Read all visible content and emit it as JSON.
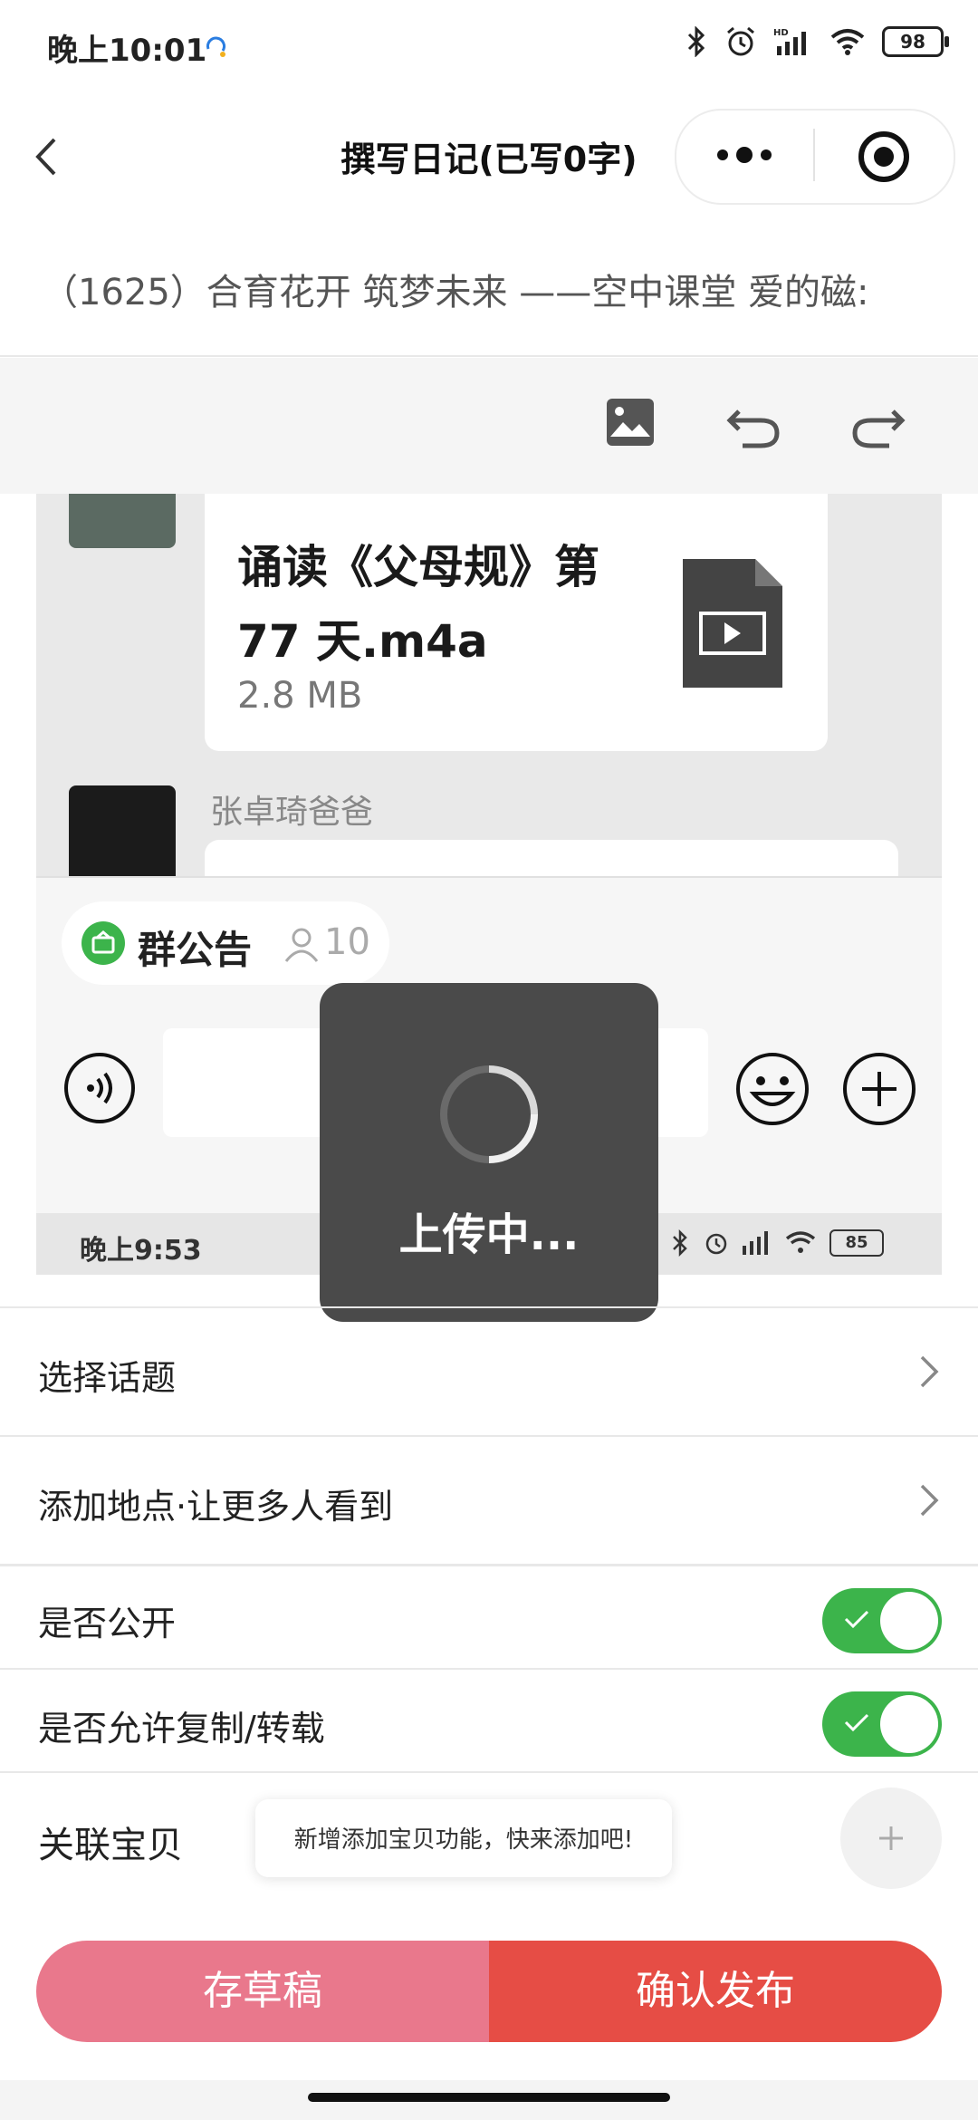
{
  "status_bar": {
    "time": "晚上10:01",
    "battery": "98"
  },
  "nav": {
    "title": "撰写日记(已写0字)"
  },
  "article": {
    "title": "（1625）合育花开 筑梦未来 ——空中课堂 爱的磁:"
  },
  "embedded_screenshot": {
    "file_name_line1": "诵读《父母规》第",
    "file_name_line2": "77 天.m4a",
    "file_size": "2.8 MB",
    "sender_name": "张卓琦爸爸",
    "group_notice_label": "群公告",
    "member_count": "10",
    "status_time": "晚上9:53",
    "status_battery": "85"
  },
  "toast": {
    "text": "上传中..."
  },
  "settings": {
    "topic_label": "选择话题",
    "location_label": "添加地点·让更多人看到",
    "public_label": "是否公开",
    "public_on": true,
    "copy_label": "是否允许复制/转载",
    "copy_on": true,
    "baby_label": "关联宝贝",
    "baby_tip": "新增添加宝贝功能，快来添加吧!"
  },
  "buttons": {
    "draft": "存草稿",
    "publish": "确认发布"
  },
  "colors": {
    "toggle_on": "#3cb44b",
    "draft_button": "#e9788c",
    "publish_button": "#e64d45",
    "toast_bg": "#4a4a4a"
  }
}
